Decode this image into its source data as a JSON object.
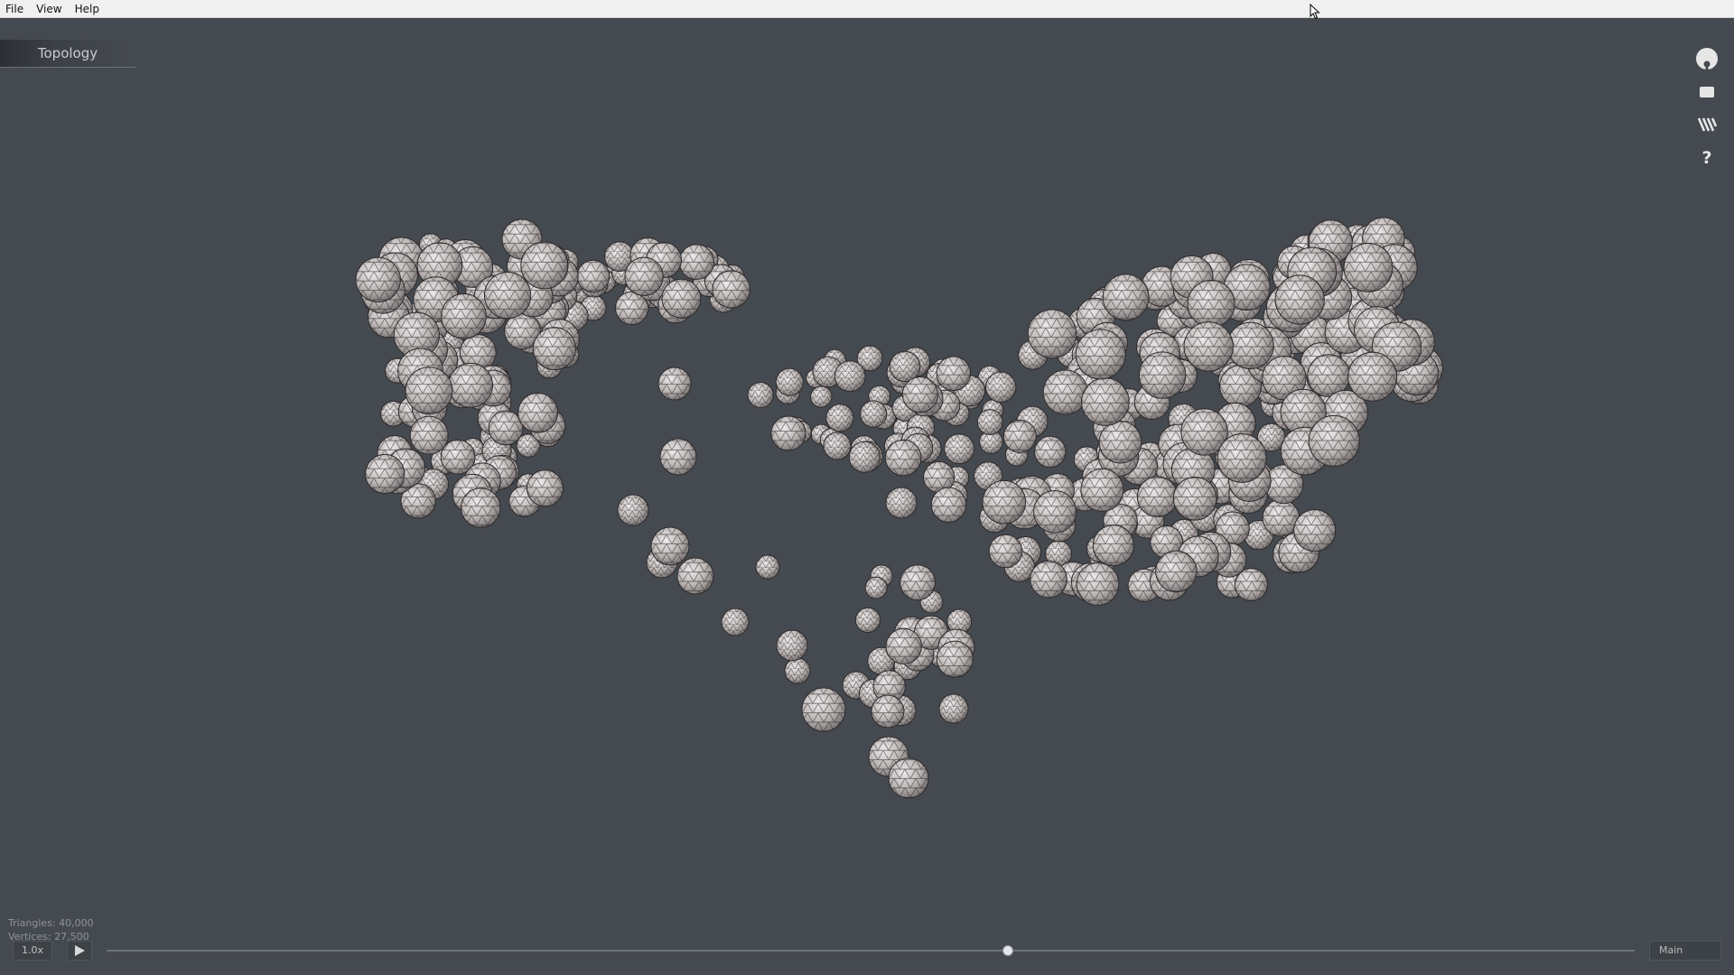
{
  "menu": {
    "items": [
      {
        "label": "File"
      },
      {
        "label": "View"
      },
      {
        "label": "Help"
      }
    ]
  },
  "viewport": {
    "tab_title": "Topology",
    "background_color": "#454a50",
    "stats": {
      "triangles": "Triangles: 40,000",
      "vertices": "Vertices: 27,500"
    }
  },
  "toolbar": {
    "tools": [
      {
        "icon": "render-sphere-icon"
      },
      {
        "icon": "screen-icon"
      },
      {
        "icon": "stripes-icon"
      },
      {
        "icon": "help-icon"
      }
    ]
  },
  "playback": {
    "speed": "1.0x",
    "play_icon": "play-icon",
    "timeline_progress": 0.59,
    "camera": "Main"
  }
}
